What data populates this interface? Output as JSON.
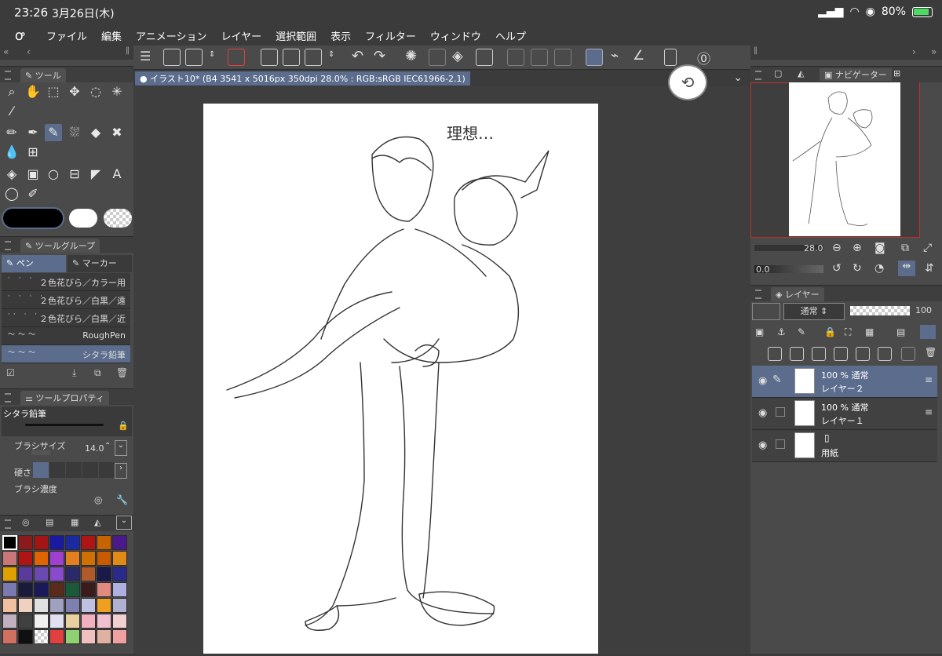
{
  "status": {
    "time": "23:26",
    "date": "3月26日(木)",
    "battery": "80%"
  },
  "menu": [
    "ファイル",
    "編集",
    "アニメーション",
    "レイヤー",
    "選択範囲",
    "表示",
    "フィルター",
    "ウィンドウ",
    "ヘルプ"
  ],
  "document": {
    "tab_title": "イラスト10* (B4 3541 x 5016px 350dpi 28.0% : RGB:sRGB IEC61966-2.1)",
    "handwritten_note": "理想…"
  },
  "tool_panel": {
    "title": "ツール"
  },
  "tool_group": {
    "title": "ツールグループ",
    "tabs": [
      "ペン",
      "マーカー"
    ]
  },
  "brushes": [
    {
      "label": "２色花びら／カラー用"
    },
    {
      "label": "２色花びら／白黒／遠"
    },
    {
      "label": "２色花びら／白黒／近"
    },
    {
      "label": "RoughPen"
    },
    {
      "label": "シタラ鉛筆"
    }
  ],
  "tool_property": {
    "title": "ツールプロパティ",
    "preset_name": "シタラ鉛筆",
    "brush_size_label": "ブラシサイズ",
    "brush_size_value": "14.0",
    "hardness_label": "硬さ",
    "density_label": "ブラシ濃度"
  },
  "navigator": {
    "title": "ナビゲーター",
    "zoom": "28.0",
    "rotation": "0.0"
  },
  "layers": {
    "title": "レイヤー",
    "blend_mode": "通常",
    "opacity": "100",
    "items": [
      {
        "opacity_mode": "100 %  通常",
        "name": "レイヤー２",
        "selected": true
      },
      {
        "opacity_mode": "100 %  通常",
        "name": "レイヤー１",
        "selected": false
      },
      {
        "opacity_mode": "",
        "name": "用紙",
        "selected": false
      }
    ]
  },
  "palette_colors": [
    "#000000",
    "#8b1a1a",
    "#a31515",
    "#1a1aa0",
    "#1a2aa0",
    "#b01515",
    "#c86400",
    "#4a1a8c",
    "#c87878",
    "#b01515",
    "#e06400",
    "#a040d0",
    "#e08020",
    "#d07000",
    "#c85a00",
    "#e08a1a",
    "#e0a000",
    "#5a3a9a",
    "#6a4ab0",
    "#8a4acc",
    "#2a2a6a",
    "#b05a2a",
    "#1a1a4a",
    "#2a2a8a",
    "#7a7ab0",
    "#1a1a3a",
    "#1a1a5a",
    "#5a2a1a",
    "#1a5a3a",
    "#3a1a1a",
    "#e08a80",
    "#b0b0e0",
    "#f0c0a0",
    "#f0d0c0",
    "#e0e0e0",
    "#a0a0c0",
    "#8080b0",
    "#c0c0e0",
    "#f0a020",
    "#b0b0d0",
    "#c0b0c0",
    "#404040",
    "#f0f0f0",
    "#e0e0f0",
    "#e8d0a0",
    "#f0b0c0",
    "#f0c0d0",
    "#f0d0d0",
    "#d07060",
    "#101010",
    "#checker",
    "#e04040",
    "#90d070",
    "#f0c0c0",
    "#e0b0a0",
    "#f0a0a0"
  ],
  "accent": "#5b6c8c"
}
